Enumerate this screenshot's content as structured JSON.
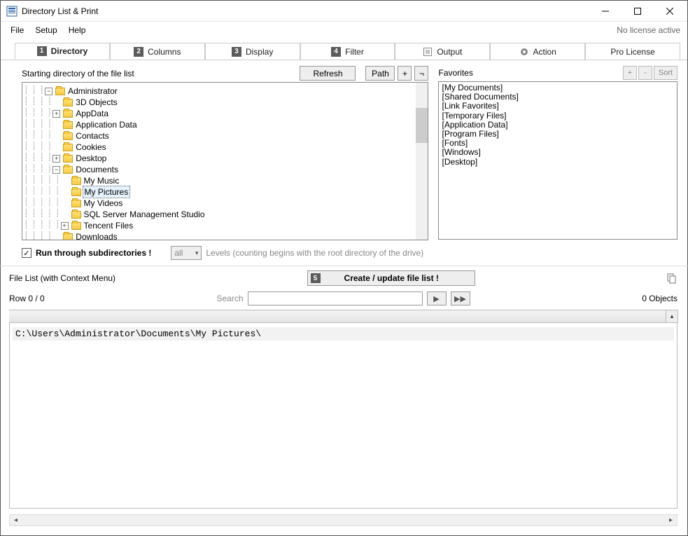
{
  "window": {
    "title": "Directory List & Print"
  },
  "menu": {
    "file": "File",
    "setup": "Setup",
    "help": "Help"
  },
  "license_status": "No license active",
  "tabs": [
    {
      "num": "1",
      "label": "Directory",
      "full": " Directory"
    },
    {
      "num": "2",
      "label": "Columns",
      "full": " Columns"
    },
    {
      "num": "3",
      "label": "Display",
      "full": " Display"
    },
    {
      "num": "4",
      "label": "Filter",
      "full": " Filter"
    },
    {
      "icon": "output",
      "label": "Output",
      "full": " Output"
    },
    {
      "icon": "gear",
      "label": "Action",
      "full": " Action"
    },
    {
      "label": "Pro License"
    }
  ],
  "labels": {
    "starting_dir": "Starting directory of the file list",
    "refresh": "Refresh",
    "path": "Path",
    "plus": "+",
    "neg": "¬",
    "favorites": "Favorites",
    "fav_plus": "+",
    "fav_minus": "-",
    "fav_sort": "Sort",
    "run_sub": "Run through subdirectories !",
    "levels_combo": "all",
    "levels_txt": "Levels  (counting begins with the root directory of the drive)",
    "file_list": "File List (with Context Menu)",
    "create_num": "5",
    "create_label": "Create / update file list !",
    "row_count": "Row 0 / 0",
    "search": "Search",
    "objects": "0 Objects"
  },
  "tree": [
    {
      "indent": 3,
      "exp": "-",
      "name": "Administrator"
    },
    {
      "indent": 4,
      "exp": "",
      "name": "3D Objects"
    },
    {
      "indent": 4,
      "exp": "+",
      "name": "AppData"
    },
    {
      "indent": 4,
      "exp": "",
      "name": "Application Data"
    },
    {
      "indent": 4,
      "exp": "",
      "name": "Contacts"
    },
    {
      "indent": 4,
      "exp": "",
      "name": "Cookies"
    },
    {
      "indent": 4,
      "exp": "+",
      "name": "Desktop"
    },
    {
      "indent": 4,
      "exp": "-",
      "name": "Documents"
    },
    {
      "indent": 5,
      "exp": "",
      "name": "My Music"
    },
    {
      "indent": 5,
      "exp": "",
      "name": "My Pictures",
      "selected": true
    },
    {
      "indent": 5,
      "exp": "",
      "name": "My Videos"
    },
    {
      "indent": 5,
      "exp": "",
      "name": "SQL Server Management Studio"
    },
    {
      "indent": 5,
      "exp": "+",
      "name": "Tencent Files"
    },
    {
      "indent": 4,
      "exp": "",
      "name": "Downloads"
    }
  ],
  "favorites": [
    "[My Documents]",
    "[Shared Documents]",
    "[Link Favorites]",
    "[Temporary Files]",
    "[Application Data]",
    "[Program Files]",
    "[Fonts]",
    "[Windows]",
    "[Desktop]"
  ],
  "output_path": "C:\\Users\\Administrator\\Documents\\My Pictures\\"
}
